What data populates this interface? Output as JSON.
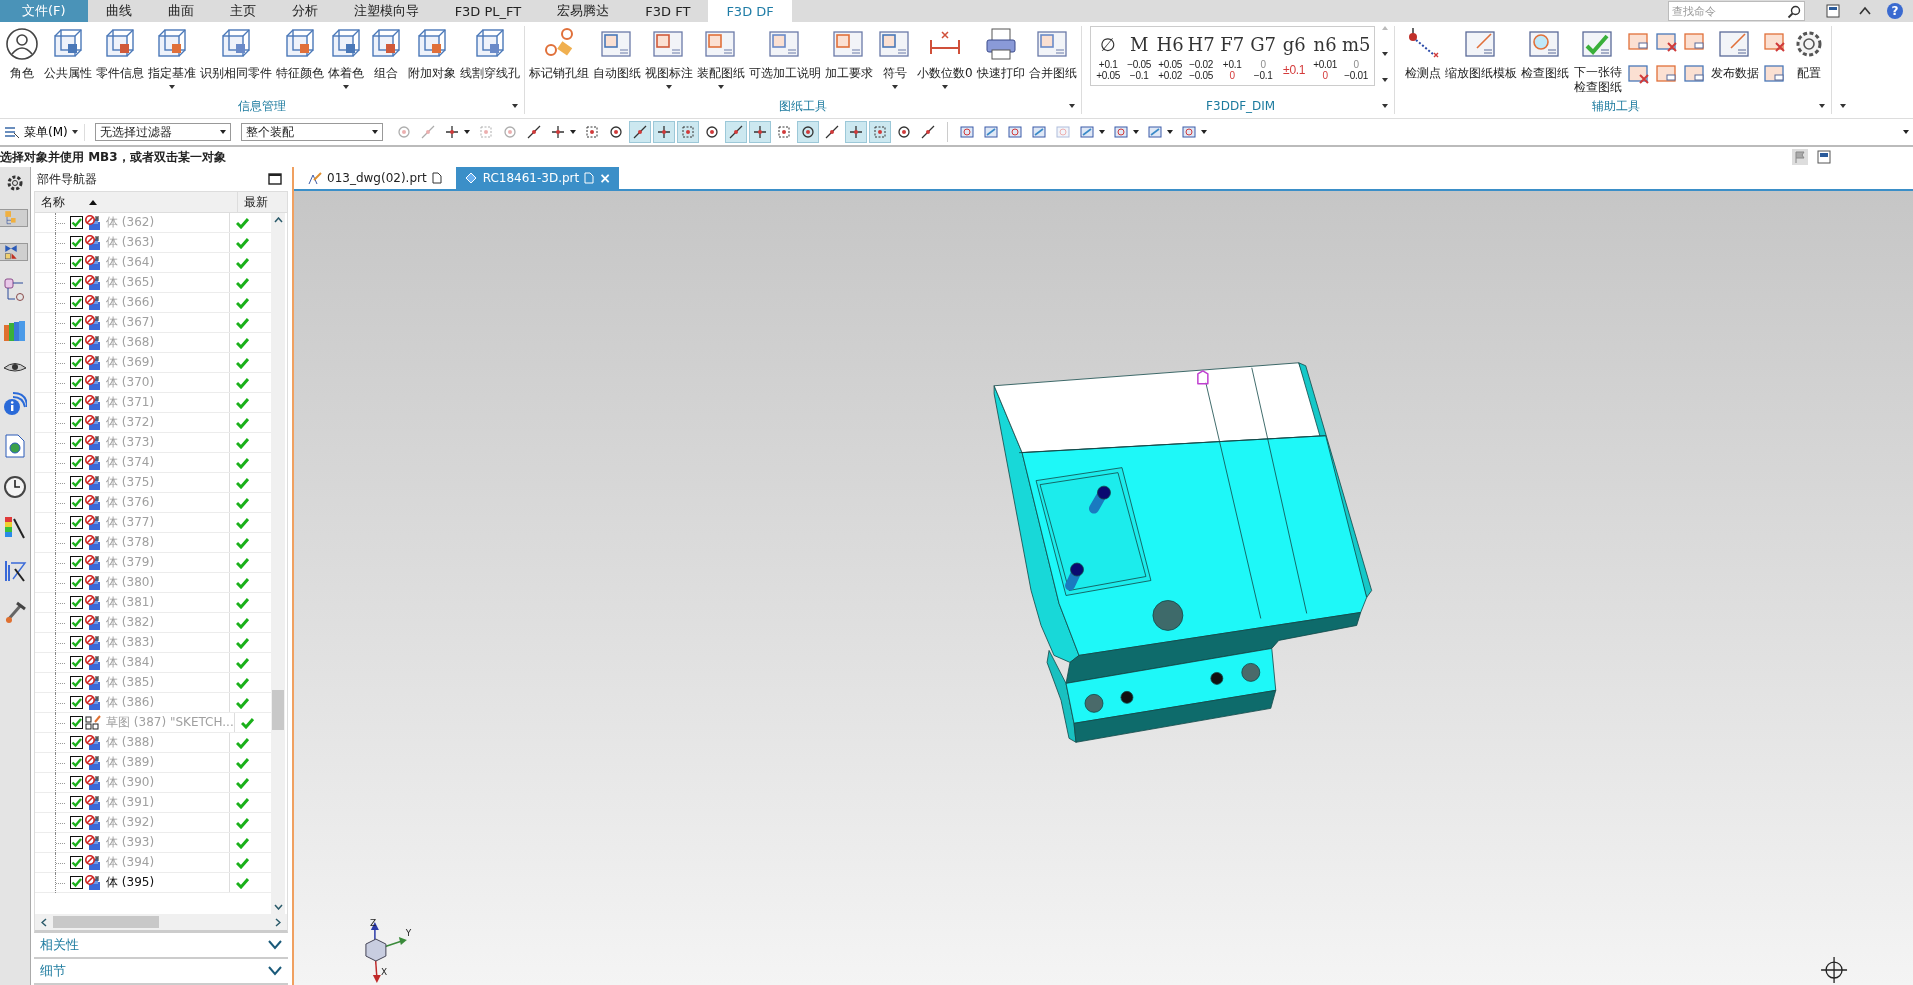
{
  "menu_tabs": [
    {
      "label": "文件(F)",
      "kind": "file",
      "selected": false
    },
    {
      "label": "曲线",
      "kind": "tab",
      "selected": false
    },
    {
      "label": "曲面",
      "kind": "tab",
      "selected": false
    },
    {
      "label": "主页",
      "kind": "tab",
      "selected": false
    },
    {
      "label": "分析",
      "kind": "tab",
      "selected": false
    },
    {
      "label": "注塑模向导",
      "kind": "tab",
      "selected": false
    },
    {
      "label": "F3D PL_FT",
      "kind": "tab",
      "selected": false
    },
    {
      "label": "宏易腾达",
      "kind": "tab",
      "selected": false
    },
    {
      "label": "F3D FT",
      "kind": "tab",
      "selected": false
    },
    {
      "label": "F3D DF",
      "kind": "tab",
      "selected": true
    }
  ],
  "search": {
    "placeholder": "查找命令"
  },
  "help_glyph": "?",
  "ribbon_groups": [
    {
      "title": "信息管理",
      "buttons": [
        {
          "label": "角色",
          "dropdown": false
        },
        {
          "label": "公共属性",
          "dropdown": false
        },
        {
          "label": "零件信息",
          "dropdown": false
        },
        {
          "label": "指定基准",
          "dropdown": true
        },
        {
          "label": "识别相同零件",
          "dropdown": false
        },
        {
          "label": "特征颜色",
          "dropdown": false
        },
        {
          "label": "体着色",
          "dropdown": true
        },
        {
          "label": "组合",
          "dropdown": false
        },
        {
          "label": "附加对象",
          "dropdown": false
        },
        {
          "label": "线割穿线孔",
          "dropdown": false
        }
      ]
    },
    {
      "title": "图纸工具",
      "buttons": [
        {
          "label": "标记销孔组",
          "dropdown": false
        },
        {
          "label": "自动图纸",
          "dropdown": false
        },
        {
          "label": "视图标注",
          "dropdown": true
        },
        {
          "label": "装配图纸",
          "dropdown": true
        },
        {
          "label": "可选加工说明",
          "dropdown": false
        },
        {
          "label": "加工要求",
          "dropdown": false
        },
        {
          "label": "符号",
          "dropdown": true
        },
        {
          "label": "小数位数0",
          "dropdown": true
        },
        {
          "label": "快速打印",
          "dropdown": false
        },
        {
          "label": "合并图纸",
          "dropdown": false
        }
      ]
    }
  ],
  "dim_group": {
    "title": "F3DDF_DIM",
    "fits": [
      {
        "kind": "stacked",
        "symbol": "∅",
        "upper": "+0.1",
        "lower": "+0.05",
        "upper_muted": false,
        "lower_red": false
      },
      {
        "kind": "stacked",
        "symbol": "M",
        "upper": "−0.05",
        "lower": "−0.1",
        "upper_muted": false,
        "lower_red": false
      },
      {
        "kind": "stacked",
        "symbol": "H6",
        "upper": "+0.05",
        "lower": "+0.02",
        "upper_muted": false,
        "lower_red": false
      },
      {
        "kind": "stacked",
        "symbol": "H7",
        "upper": "−0.02",
        "lower": "−0.05",
        "upper_muted": false,
        "lower_red": false
      },
      {
        "kind": "stacked",
        "symbol": "F7",
        "upper": "+0.1",
        "lower": "0",
        "upper_muted": false,
        "lower_red": true
      },
      {
        "kind": "stacked",
        "symbol": "G7",
        "upper": "0",
        "lower": "−0.1",
        "upper_muted": true,
        "lower_red": false
      },
      {
        "kind": "single",
        "symbol": "g6",
        "value": "±0.1",
        "red": true
      },
      {
        "kind": "stacked",
        "symbol": "n6",
        "upper": "+0.01",
        "lower": "0",
        "upper_muted": false,
        "lower_red": true
      },
      {
        "kind": "stacked",
        "symbol": "m5",
        "upper": "0",
        "lower": "−0.01",
        "upper_muted": true,
        "lower_red": false
      }
    ]
  },
  "aux_group": {
    "title": "辅助工具",
    "buttons": [
      {
        "kind": "large",
        "label": "检测点"
      },
      {
        "kind": "large",
        "label": "缩放图纸模板"
      },
      {
        "kind": "large",
        "label": "检查图纸"
      },
      {
        "kind": "large",
        "label": "下一张待检查图纸"
      },
      {
        "kind": "icon_stack"
      },
      {
        "kind": "icon_stack"
      },
      {
        "kind": "icon_stack"
      },
      {
        "kind": "large",
        "label": "发布数据"
      },
      {
        "kind": "icon_stack"
      },
      {
        "kind": "large",
        "label": "配置"
      }
    ]
  },
  "toolbar": {
    "menu_label": "菜单(M)",
    "filter": "无选择过滤器",
    "scope": "整个装配",
    "snap_tools": [
      {
        "selected": false,
        "dropdown": false,
        "disabled": true
      },
      {
        "selected": false,
        "dropdown": false,
        "disabled": true
      },
      {
        "selected": false,
        "dropdown": true,
        "disabled": false
      },
      {
        "selected": false,
        "dropdown": false,
        "disabled": true
      },
      {
        "selected": false,
        "dropdown": false,
        "disabled": true
      },
      {
        "selected": false,
        "dropdown": false,
        "disabled": false
      },
      {
        "selected": false,
        "dropdown": true,
        "disabled": false
      },
      {
        "selected": false,
        "dropdown": false,
        "disabled": false
      },
      {
        "selected": false,
        "dropdown": false,
        "disabled": false
      },
      {
        "selected": true,
        "dropdown": false,
        "disabled": false
      },
      {
        "selected": true,
        "dropdown": false,
        "disabled": false
      },
      {
        "selected": true,
        "dropdown": false,
        "disabled": false
      },
      {
        "selected": false,
        "dropdown": false,
        "disabled": false
      },
      {
        "selected": true,
        "dropdown": false,
        "disabled": false
      },
      {
        "selected": true,
        "dropdown": false,
        "disabled": false
      },
      {
        "selected": false,
        "dropdown": false,
        "disabled": false
      },
      {
        "selected": true,
        "dropdown": false,
        "disabled": false
      },
      {
        "selected": false,
        "dropdown": false,
        "disabled": false
      },
      {
        "selected": true,
        "dropdown": false,
        "disabled": false
      },
      {
        "selected": true,
        "dropdown": false,
        "disabled": false
      },
      {
        "selected": false,
        "dropdown": false,
        "disabled": false
      },
      {
        "selected": false,
        "dropdown": false,
        "disabled": false
      }
    ],
    "view_tools": [
      {
        "selected": false,
        "dropdown": false,
        "disabled": false
      },
      {
        "selected": false,
        "dropdown": false,
        "disabled": false
      },
      {
        "selected": false,
        "dropdown": false,
        "disabled": false
      },
      {
        "selected": false,
        "dropdown": false,
        "disabled": false
      },
      {
        "selected": false,
        "dropdown": false,
        "disabled": true
      },
      {
        "selected": false,
        "dropdown": true,
        "disabled": false
      },
      {
        "selected": false,
        "dropdown": true,
        "disabled": false
      },
      {
        "selected": false,
        "dropdown": true,
        "disabled": false
      },
      {
        "selected": false,
        "dropdown": true,
        "disabled": false
      }
    ]
  },
  "status_text": "选择对象并使用 MB3，或者双击某一对象",
  "file_tabs": [
    {
      "label": "013_dwg(02).prt",
      "selected": false,
      "closable": false
    },
    {
      "label": "RC18461-3D.prt",
      "selected": true,
      "closable": true
    }
  ],
  "close_glyph": "×",
  "navigator": {
    "title": "部件导航器",
    "columns": [
      "名称",
      "最新"
    ],
    "rows": [
      {
        "kind": "body",
        "label": "体 (362)",
        "checked": true,
        "dimmed": true,
        "up_to_date": true
      },
      {
        "kind": "body",
        "label": "体 (363)",
        "checked": true,
        "dimmed": true,
        "up_to_date": true
      },
      {
        "kind": "body",
        "label": "体 (364)",
        "checked": true,
        "dimmed": true,
        "up_to_date": true
      },
      {
        "kind": "body",
        "label": "体 (365)",
        "checked": true,
        "dimmed": true,
        "up_to_date": true
      },
      {
        "kind": "body",
        "label": "体 (366)",
        "checked": true,
        "dimmed": true,
        "up_to_date": true
      },
      {
        "kind": "body",
        "label": "体 (367)",
        "checked": true,
        "dimmed": true,
        "up_to_date": true
      },
      {
        "kind": "body",
        "label": "体 (368)",
        "checked": true,
        "dimmed": true,
        "up_to_date": true
      },
      {
        "kind": "body",
        "label": "体 (369)",
        "checked": true,
        "dimmed": true,
        "up_to_date": true
      },
      {
        "kind": "body",
        "label": "体 (370)",
        "checked": true,
        "dimmed": true,
        "up_to_date": true
      },
      {
        "kind": "body",
        "label": "体 (371)",
        "checked": true,
        "dimmed": true,
        "up_to_date": true
      },
      {
        "kind": "body",
        "label": "体 (372)",
        "checked": true,
        "dimmed": true,
        "up_to_date": true
      },
      {
        "kind": "body",
        "label": "体 (373)",
        "checked": true,
        "dimmed": true,
        "up_to_date": true
      },
      {
        "kind": "body",
        "label": "体 (374)",
        "checked": true,
        "dimmed": true,
        "up_to_date": true
      },
      {
        "kind": "body",
        "label": "体 (375)",
        "checked": true,
        "dimmed": true,
        "up_to_date": true
      },
      {
        "kind": "body",
        "label": "体 (376)",
        "checked": true,
        "dimmed": true,
        "up_to_date": true
      },
      {
        "kind": "body",
        "label": "体 (377)",
        "checked": true,
        "dimmed": true,
        "up_to_date": true
      },
      {
        "kind": "body",
        "label": "体 (378)",
        "checked": true,
        "dimmed": true,
        "up_to_date": true
      },
      {
        "kind": "body",
        "label": "体 (379)",
        "checked": true,
        "dimmed": true,
        "up_to_date": true
      },
      {
        "kind": "body",
        "label": "体 (380)",
        "checked": true,
        "dimmed": true,
        "up_to_date": true
      },
      {
        "kind": "body",
        "label": "体 (381)",
        "checked": true,
        "dimmed": true,
        "up_to_date": true
      },
      {
        "kind": "body",
        "label": "体 (382)",
        "checked": true,
        "dimmed": true,
        "up_to_date": true
      },
      {
        "kind": "body",
        "label": "体 (383)",
        "checked": true,
        "dimmed": true,
        "up_to_date": true
      },
      {
        "kind": "body",
        "label": "体 (384)",
        "checked": true,
        "dimmed": true,
        "up_to_date": true
      },
      {
        "kind": "body",
        "label": "体 (385)",
        "checked": true,
        "dimmed": true,
        "up_to_date": true
      },
      {
        "kind": "body",
        "label": "体 (386)",
        "checked": true,
        "dimmed": true,
        "up_to_date": true
      },
      {
        "kind": "sketch",
        "label": "草图 (387) \"SKETCH...",
        "checked": true,
        "dimmed": true,
        "up_to_date": true
      },
      {
        "kind": "body",
        "label": "体 (388)",
        "checked": true,
        "dimmed": true,
        "up_to_date": true
      },
      {
        "kind": "body",
        "label": "体 (389)",
        "checked": true,
        "dimmed": true,
        "up_to_date": true
      },
      {
        "kind": "body",
        "label": "体 (390)",
        "checked": true,
        "dimmed": true,
        "up_to_date": true
      },
      {
        "kind": "body",
        "label": "体 (391)",
        "checked": true,
        "dimmed": true,
        "up_to_date": true
      },
      {
        "kind": "body",
        "label": "体 (392)",
        "checked": true,
        "dimmed": true,
        "up_to_date": true
      },
      {
        "kind": "body",
        "label": "体 (393)",
        "checked": true,
        "dimmed": true,
        "up_to_date": true
      },
      {
        "kind": "body",
        "label": "体 (394)",
        "checked": true,
        "dimmed": true,
        "up_to_date": true
      },
      {
        "kind": "body",
        "label": "体 (395)",
        "checked": true,
        "dimmed": false,
        "up_to_date": true
      }
    ],
    "panels": [
      {
        "title": "相关性",
        "expanded": false
      },
      {
        "title": "细节",
        "expanded": false
      }
    ]
  },
  "triad_labels": [
    "Z",
    "Y",
    "X"
  ]
}
